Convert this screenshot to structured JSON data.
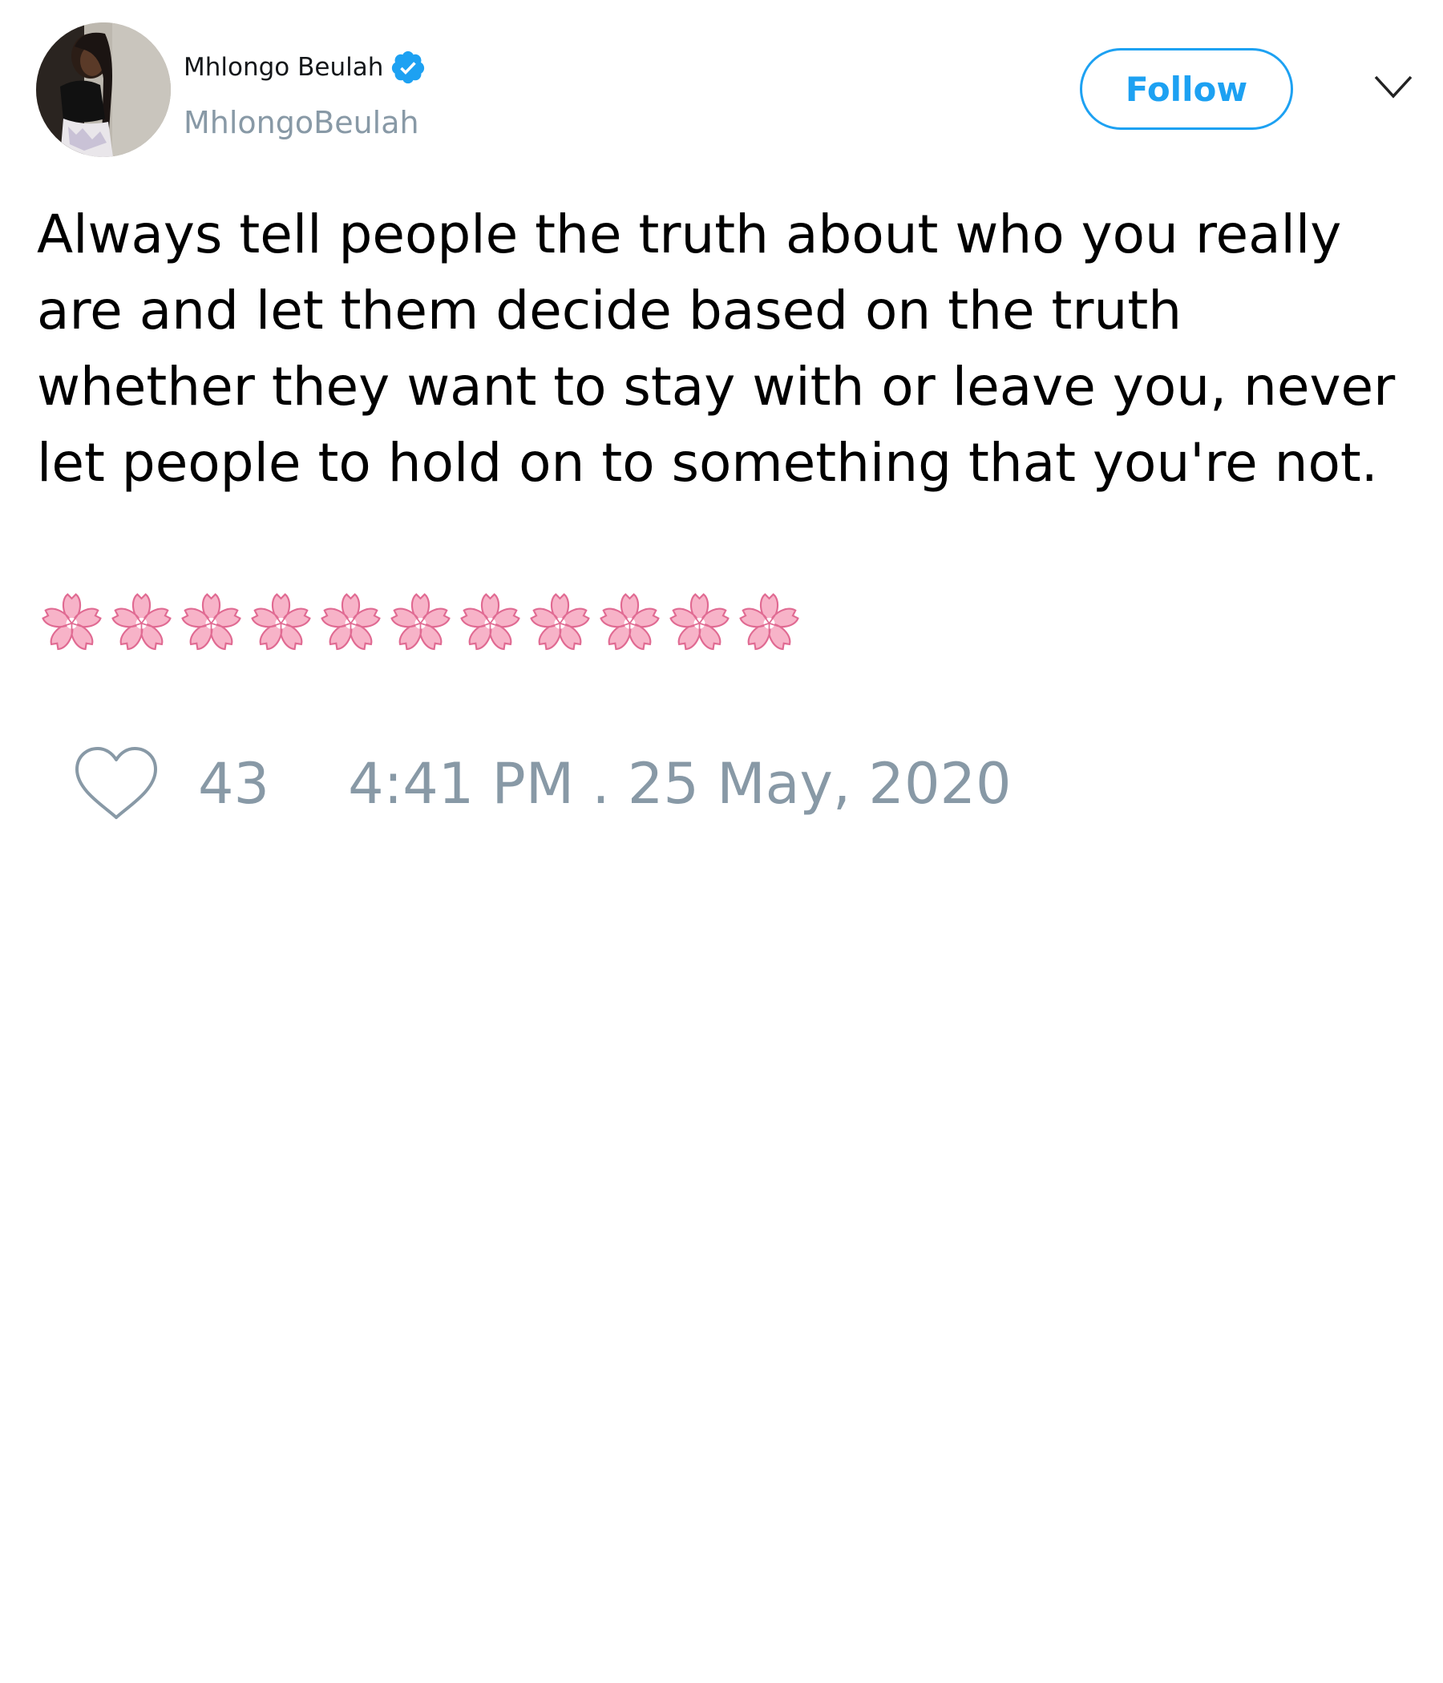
{
  "author": {
    "display_name": "Mhlongo Beulah",
    "handle": "MhlongoBeulah",
    "verified": true,
    "verified_icon": "verified-badge-icon"
  },
  "actions": {
    "follow_label": "Follow",
    "menu_icon": "chevron-down-icon"
  },
  "tweet": {
    "text": "Always tell people the truth about who you really are and let them decide based on the truth whether they want to stay with or leave you, never let people to hold on to something that you're not.",
    "emojis": [
      "cherry-blossom",
      "cherry-blossom",
      "cherry-blossom",
      "cherry-blossom",
      "cherry-blossom",
      "cherry-blossom",
      "cherry-blossom",
      "cherry-blossom",
      "cherry-blossom",
      "cherry-blossom",
      "cherry-blossom"
    ]
  },
  "footer": {
    "like_icon": "heart-icon",
    "like_count": "43",
    "timestamp": "4:41 PM . 25 May, 2020"
  },
  "colors": {
    "accent": "#1da1f2",
    "muted": "#8899a6",
    "text": "#000000",
    "background": "#ffffff"
  }
}
